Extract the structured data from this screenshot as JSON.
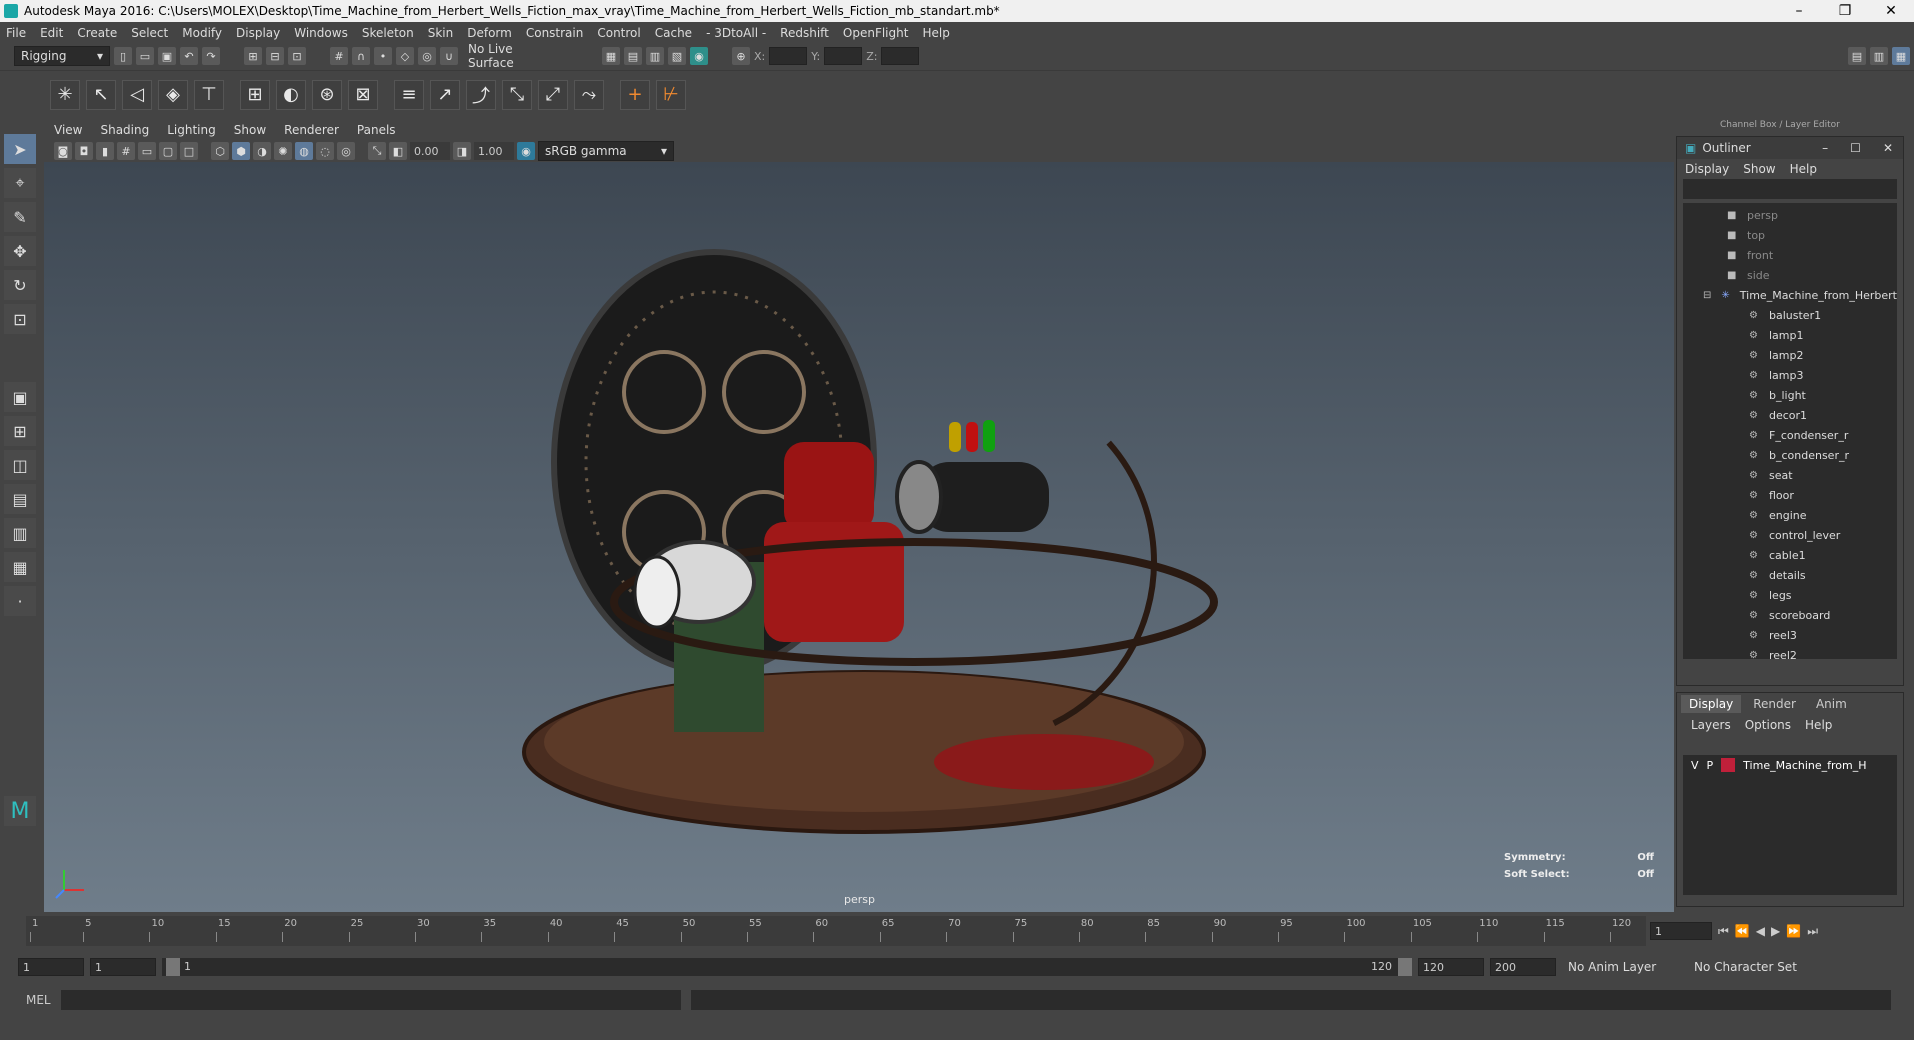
{
  "window": {
    "title": "Autodesk Maya 2016: C:\\Users\\MOLEX\\Desktop\\Time_Machine_from_Herbert_Wells_Fiction_max_vray\\Time_Machine_from_Herbert_Wells_Fiction_mb_standart.mb*",
    "minimize": "–",
    "restore": "❐",
    "close": "✕"
  },
  "menu": [
    "File",
    "Edit",
    "Create",
    "Select",
    "Modify",
    "Display",
    "Windows",
    "Skeleton",
    "Skin",
    "Deform",
    "Constrain",
    "Control",
    "Cache",
    "- 3DtoAll -",
    "Redshift",
    "OpenFlight",
    "Help"
  ],
  "statusline": {
    "mode": "Rigging",
    "live_surface": "No Live Surface",
    "x_label": "X:",
    "y_label": "Y:",
    "z_label": "Z:"
  },
  "panel": {
    "menu": [
      "View",
      "Shading",
      "Lighting",
      "Show",
      "Renderer",
      "Panels"
    ],
    "exposure": "0.00",
    "gamma": "1.00",
    "color_space": "sRGB gamma",
    "camera": "persp",
    "symmetry_label": "Symmetry:",
    "symmetry_value": "Off",
    "soft_select_label": "Soft Select:",
    "soft_select_value": "Off"
  },
  "outliner": {
    "title": "Outliner",
    "menu": [
      "Display",
      "Show",
      "Help"
    ],
    "cameras": [
      "persp",
      "top",
      "front",
      "side"
    ],
    "root": "Time_Machine_from_Herbert",
    "children": [
      "baluster1",
      "lamp1",
      "lamp2",
      "lamp3",
      "b_light",
      "decor1",
      "F_condenser_r",
      "b_condenser_r",
      "seat",
      "floor",
      "engine",
      "control_lever",
      "cable1",
      "details",
      "legs",
      "scoreboard",
      "reel3",
      "reel2"
    ]
  },
  "layer_editor": {
    "header": "Channel Box / Layer Editor",
    "tabs": [
      "Display",
      "Render",
      "Anim"
    ],
    "menu": [
      "Layers",
      "Options",
      "Help"
    ],
    "layer": {
      "v": "V",
      "p": "P",
      "name": "Time_Machine_from_H",
      "color": "#c0203a"
    }
  },
  "timeline": {
    "ticks": [
      "1",
      "5",
      "10",
      "15",
      "20",
      "25",
      "30",
      "35",
      "40",
      "45",
      "50",
      "55",
      "60",
      "65",
      "70",
      "75",
      "80",
      "85",
      "90",
      "95",
      "100",
      "105",
      "110",
      "115",
      "120"
    ],
    "current_frame": "1"
  },
  "range": {
    "start": "1",
    "anim_start": "1",
    "slider_start": "1",
    "slider_end": "120",
    "anim_end": "120",
    "end": "200",
    "anim_layer": "No Anim Layer",
    "character_set": "No Character Set"
  },
  "command": {
    "language": "MEL"
  }
}
